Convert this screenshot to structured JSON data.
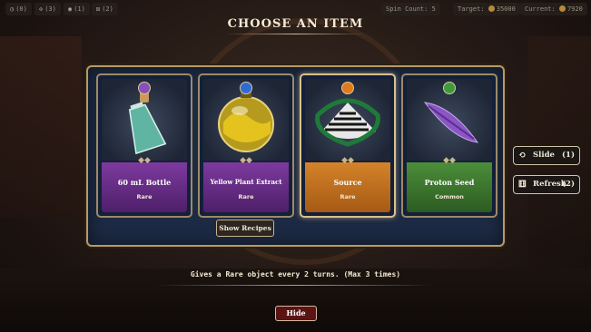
{
  "topbar": {
    "stat1": {
      "icon": "clock-icon",
      "value": "(0)"
    },
    "stat2": {
      "icon": "puzzle-icon",
      "value": "(3)"
    },
    "stat3": {
      "icon": "coin-stack-icon",
      "value": "(1)"
    },
    "stat4": {
      "icon": "dice-icon",
      "value": "(2)"
    },
    "spin_count": "Spin Count: 5",
    "target": "Target:",
    "target_value": "35000",
    "current": "Current:",
    "current_value": "7920"
  },
  "title": "CHOOSE AN ITEM",
  "cards": [
    {
      "name": "60 mL Bottle",
      "rarity": "Rare",
      "color": "purple",
      "gem_color": "#8a4fb8",
      "icon": "bottle-icon"
    },
    {
      "name": "Yellow Plant Extract",
      "rarity": "Rare",
      "color": "purple",
      "gem_color": "#2f6bd2",
      "icon": "flask-icon"
    },
    {
      "name": "Source",
      "rarity": "Rare",
      "color": "orange",
      "gem_color": "#e07a1a",
      "icon": "source-icon"
    },
    {
      "name": "Proton Seed",
      "rarity": "Common",
      "color": "green",
      "gem_color": "#3f9a3a",
      "icon": "leaf-seed-icon"
    }
  ],
  "show_recipes": "Show Recipes",
  "slide": {
    "label": "Slide",
    "count": "(1)",
    "icon": "slide-arrows-icon"
  },
  "refresh": {
    "label": "Refresh",
    "count": "(2)",
    "icon": "refresh-dice-icon"
  },
  "description": "Gives a Rare object every 2 turns. (Max 3 times)",
  "hide": "Hide"
}
